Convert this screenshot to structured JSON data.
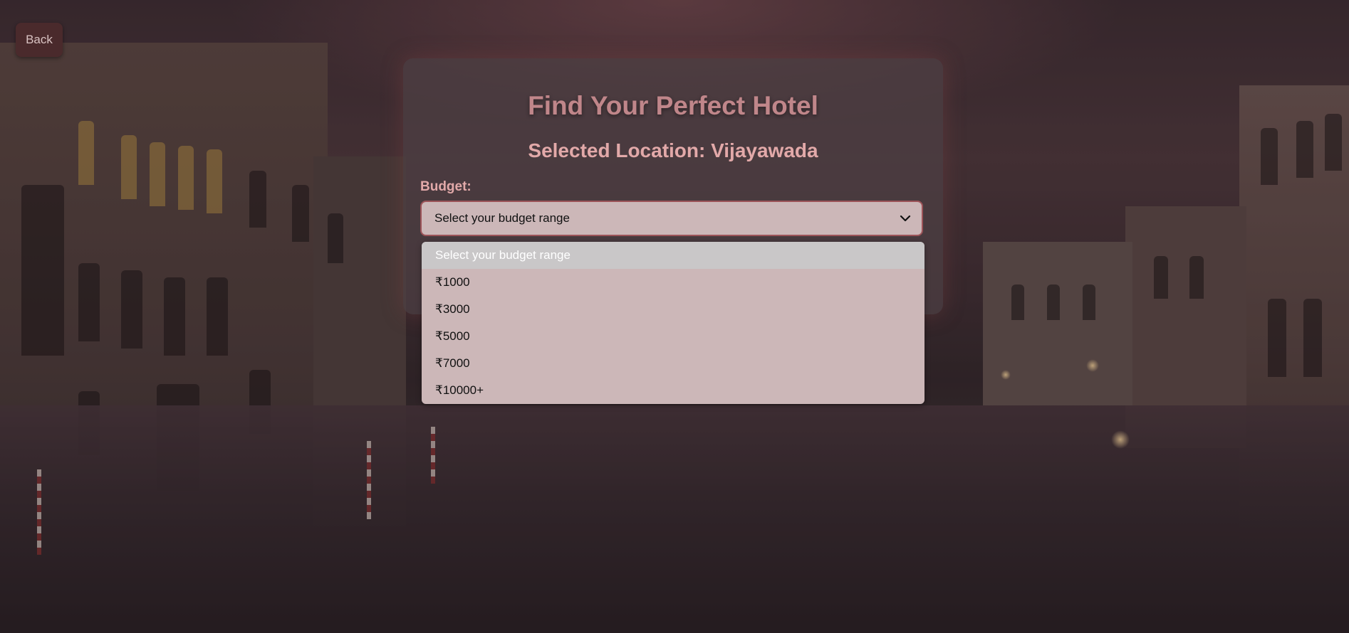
{
  "back_button": {
    "label": "Back"
  },
  "card": {
    "title": "Find Your Perfect Hotel",
    "location_heading": "Selected Location: Vijayawada",
    "budget_label": "Budget:",
    "budget_select_value": "Select your budget range"
  },
  "dropdown": {
    "options": [
      {
        "label": "Select your budget range",
        "selected": true
      },
      {
        "label": "₹1000"
      },
      {
        "label": "₹3000"
      },
      {
        "label": "₹5000"
      },
      {
        "label": "₹7000"
      },
      {
        "label": "₹10000+"
      }
    ]
  },
  "colors": {
    "title": "#c0868a",
    "accent_text": "#e2a9a9",
    "select_bg": "#ccb7b8",
    "select_border": "#9c5358",
    "back_bg": "#4a2a2c"
  }
}
